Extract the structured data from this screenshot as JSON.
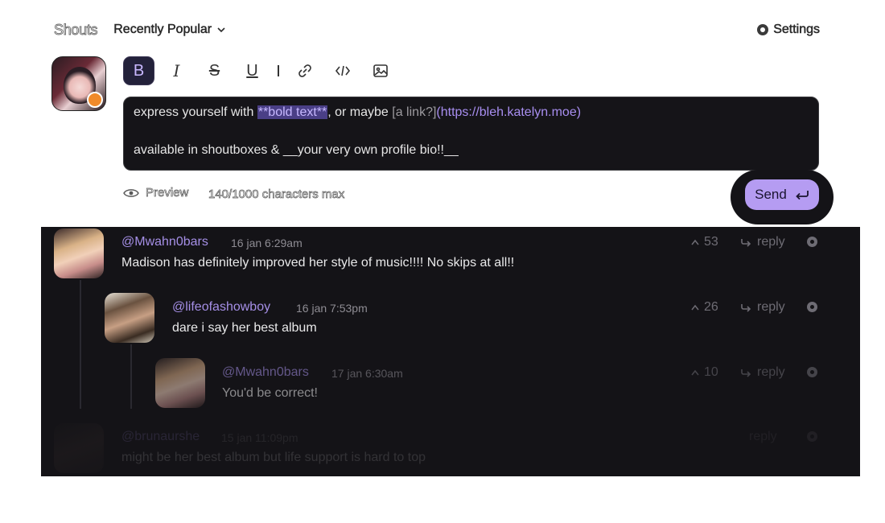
{
  "header": {
    "title": "Shouts",
    "sort_label": "Recently Popular",
    "settings_label": "Settings"
  },
  "toolbar": {
    "bold": "B",
    "italic": "I",
    "strike": "S",
    "underline": "U"
  },
  "editor": {
    "line1_prefix": "express yourself with ",
    "line1_bold": "**bold text**",
    "line1_mid": ", or maybe ",
    "line1_link_label": "[a link?]",
    "line1_link_url": "(https://bleh.katelyn.moe)",
    "line2": "available in shoutboxes & __your very own profile bio!!__"
  },
  "composer": {
    "preview_label": "Preview",
    "char_count": "140/1000 characters max",
    "send_label": "Send"
  },
  "comments": [
    {
      "user": "@Mwahn0bars",
      "time": "16 jan 6:29am",
      "body": "Madison has definitely improved her style of music!!!! No skips at all!!",
      "score": "53",
      "reply_label": "reply"
    },
    {
      "user": "@lifeofashowboy",
      "time": "16 jan 7:53pm",
      "body": "dare i say her best album",
      "score": "26",
      "reply_label": "reply"
    },
    {
      "user": "@Mwahn0bars",
      "time": "17 jan 6:30am",
      "body": "You'd be correct!",
      "score": "10",
      "reply_label": "reply"
    },
    {
      "user": "@brunaurshe",
      "time": "15 jan 11:09pm",
      "body": "might be her best album but life support is hard to top",
      "score": "",
      "reply_label": "reply"
    }
  ],
  "colors": {
    "accent": "#b59cf2",
    "username": "#a58fe6",
    "feed_bg": "#141317",
    "editor_bg": "#151418"
  },
  "icons": [
    "chevron-down-icon",
    "gear-icon",
    "bold-icon",
    "italic-icon",
    "strikethrough-icon",
    "underline-icon",
    "link-icon",
    "code-icon",
    "image-icon",
    "eye-icon",
    "enter-icon",
    "upvote-icon",
    "reply-icon"
  ]
}
